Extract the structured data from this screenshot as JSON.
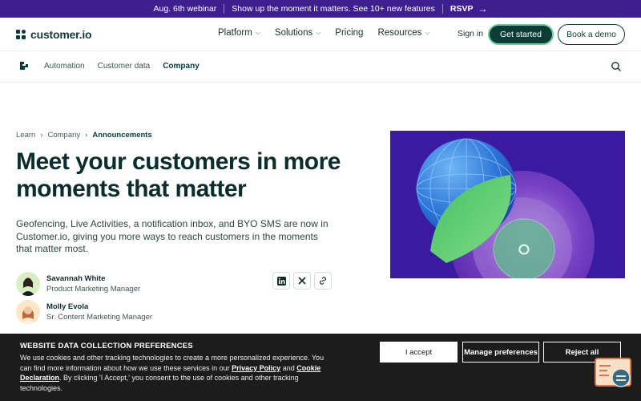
{
  "banner": {
    "date": "Aug. 6th webinar",
    "message": "Show up the moment it matters. See 10+ new features",
    "rsvp": "RSVP",
    "bg_color": "#3d1f8f"
  },
  "nav": {
    "logo_text": "customer.io",
    "links": [
      "Platform",
      "Solutions",
      "Pricing",
      "Resources"
    ],
    "sign_in": "Sign in",
    "get_started": "Get started",
    "book_demo": "Book a demo",
    "accent_color": "#0c3c36"
  },
  "subnav": {
    "links": [
      "Automation",
      "Customer data",
      "Company"
    ],
    "active": "Company"
  },
  "breadcrumb": [
    "Learn",
    "Company",
    "Announcements"
  ],
  "article": {
    "title": "Meet your customers in more moments that matter",
    "description": "Geofencing, Live Activities, a notification inbox, and BYO SMS are now in Customer.io, giving you more ways to reach customers in the moments that matter most.",
    "authors": [
      {
        "name": "Savannah White",
        "role": "Product Marketing Manager"
      },
      {
        "name": "Molly Evola",
        "role": "Sr. Content Marketing Manager"
      }
    ],
    "share_icons": [
      "linkedin-icon",
      "x-icon",
      "link-icon"
    ]
  },
  "cookie": {
    "heading": "WEBSITE DATA COLLECTION PREFERENCES",
    "text_1": "We use cookies and other tracking technologies to create a more personalized experience. You can find more information about how we use these services in our ",
    "privacy_link": "Privacy Policy",
    "text_2": " and ",
    "cookie_link": "Cookie Declaration",
    "text_3": ". By clicking 'I Accept,' you consent to the use of cookies and other tracking technologies.",
    "accept": "I accept",
    "manage": "Manage preferences",
    "reject": "Reject all"
  }
}
